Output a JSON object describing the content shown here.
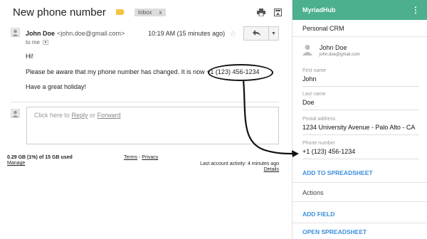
{
  "email": {
    "subject": "New phone number",
    "label_chip": "Inbox",
    "label_chip_close": "x",
    "sender_name": "John Doe",
    "sender_email": "<john.doe@gmail.com>",
    "timestamp": "10:19 AM (15 minutes ago)",
    "to_text": "to me",
    "body": {
      "greeting": "Hi!",
      "line_prefix": "Please be aware that my phone number has changed. It is now",
      "phone": "+1 (123) 456-1234",
      "closing": "Have a great holiday!"
    },
    "reply_box": {
      "prefix": "Click here to ",
      "reply": "Reply",
      "or": " or ",
      "forward": "Forward"
    },
    "footer": {
      "storage": "0.29 GB (1%) of 15 GB used",
      "manage": "Manage",
      "terms": "Terms",
      "dash": " - ",
      "privacy": "Privacy",
      "activity": "Last account activity: 4 minutes ago",
      "details": "Details"
    },
    "icons": [
      "print-icon",
      "new-window-icon",
      "star-icon",
      "reply-icon",
      "more-icon"
    ]
  },
  "panel": {
    "app_name": "MyriadHub",
    "menu_icon": "⋮",
    "section_title": "Personal CRM",
    "contact_name": "John Doe",
    "contact_email": "john.doe@gmail.com",
    "fields": [
      {
        "label": "First name",
        "value": "John"
      },
      {
        "label": "Last name",
        "value": "Doe"
      },
      {
        "label": "Postal address",
        "value": "1234 University Avenue - Palo Alto - CA"
      },
      {
        "label": "Phone number",
        "value": "+1 (123) 456-1234"
      }
    ],
    "add_to_spreadsheet": "ADD TO SPREADSHEET",
    "actions_heading": "Actions",
    "add_field": "ADD FIELD",
    "open_spreadsheet": "OPEN SPREADSHEET",
    "header_color": "#4caf8e",
    "link_color": "#3b8ed8"
  }
}
